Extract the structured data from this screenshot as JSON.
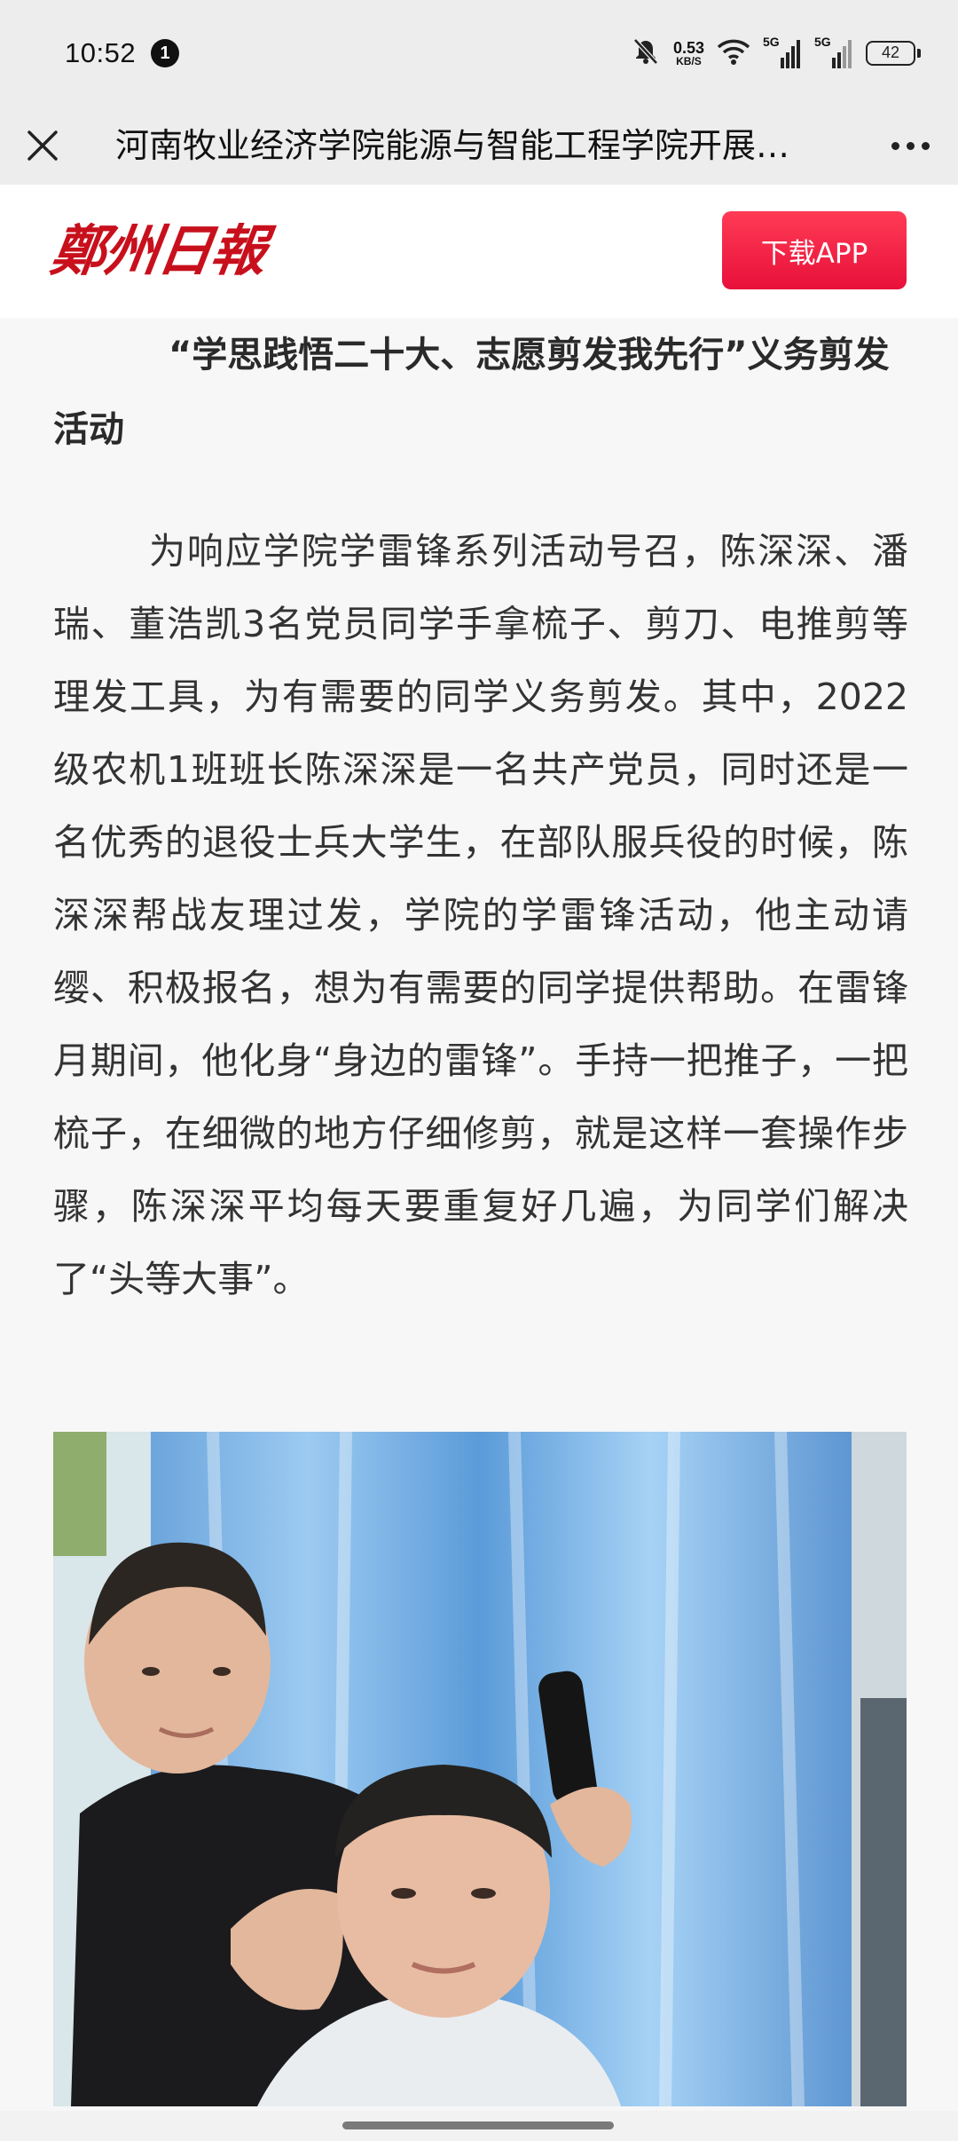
{
  "status_bar": {
    "time": "10:52",
    "notification_count": "1",
    "net_speed_value": "0.53",
    "net_speed_unit": "KB/S",
    "network_1": "5G",
    "network_2": "5G",
    "battery": "42",
    "icons": [
      "mute-bell-icon",
      "wifi-icon",
      "signal-icon",
      "battery-icon"
    ]
  },
  "title_bar": {
    "title": "河南牧业经济学院能源与智能工程学院开展…",
    "close_icon": "close-icon",
    "more_icon": "more-icon"
  },
  "brand": {
    "logo_text": "鄭州日報",
    "download_label": "下载APP",
    "accent_color": "#e8103a",
    "logo_color": "#c8101d"
  },
  "article": {
    "heading": "“学思践悟二十大、志愿剪发我先行”义务剪发活动",
    "paragraph": "为响应学院学雷锋系列活动号召，陈深深、潘瑞、董浩凯3名党员同学手拿梳子、剪刀、电推剪等理发工具，为有需要的同学义务剪发。其中，2022级农机1班班长陈深深是一名共产党员，同时还是一名优秀的退役士兵大学生，在部队服兵役的时候，陈深深帮战友理过发，学院的学雷锋活动，他主动请缨、积极报名，想为有需要的同学提供帮助。在雷锋月期间，他化身“身边的雷锋”。手持一把推子，一把梳子，在细微的地方仔细修剪，就是这样一套操作步骤，陈深深平均每天要重复好几遍，为同学们解决了“头等大事”。",
    "photo_subject": "photo-haircut"
  }
}
